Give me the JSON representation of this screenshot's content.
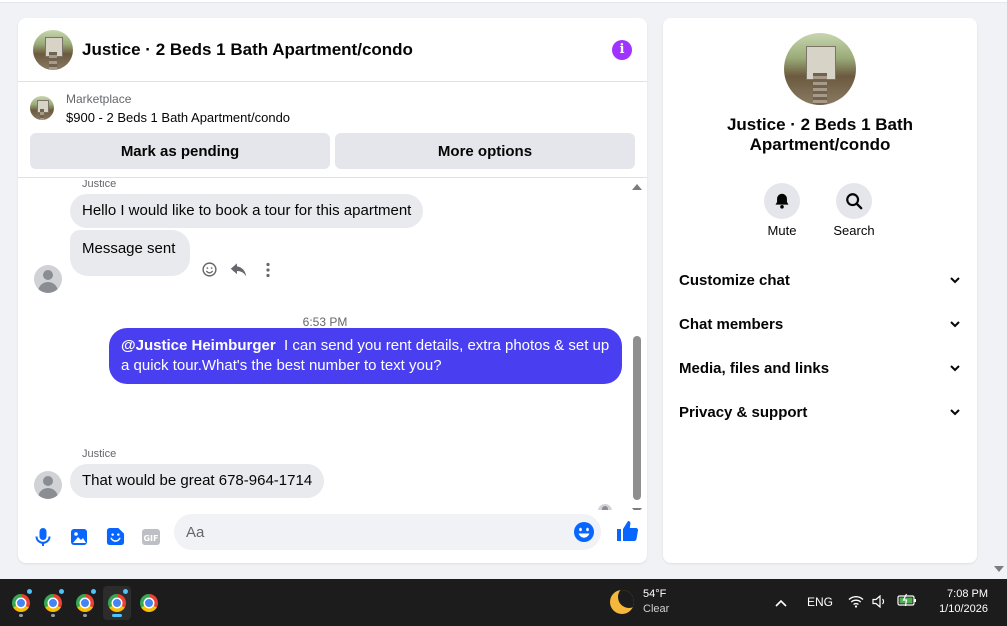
{
  "chat": {
    "title": "Justice · 2 Beds 1 Bath Apartment/condo",
    "marketplace": {
      "label": "Marketplace",
      "listing": "$900 - 2 Beds 1 Bath Apartment/condo",
      "mark_pending_label": "Mark as pending",
      "more_options_label": "More options"
    },
    "messages": {
      "sender_1": "Justice",
      "msg_1": "Hello I would like to book a tour for this apartment",
      "msg_2": "Message sent",
      "time": "6:53 PM",
      "out_mention": "@Justice Heimburger",
      "out_text": "  I can send you rent details, extra photos & set up a quick tour.What's the best number to text you?",
      "sender_2": "Justice",
      "msg_3": "That would be great 678-964-1714"
    },
    "composer": {
      "placeholder": "Aa"
    }
  },
  "info": {
    "title": "Justice · 2 Beds 1 Bath Apartment/condo",
    "mute_label": "Mute",
    "search_label": "Search",
    "sections": [
      "Customize chat",
      "Chat members",
      "Media, files and links",
      "Privacy & support"
    ]
  },
  "taskbar": {
    "weather_temp": "54°F",
    "weather_desc": "Clear",
    "lang": "ENG",
    "time": "7:08 PM",
    "date": "1/10/2026"
  },
  "colors": {
    "accent": "#a033ff",
    "outgoing_bubble": "#4a3ff0",
    "messenger_blue": "#0866ff"
  }
}
